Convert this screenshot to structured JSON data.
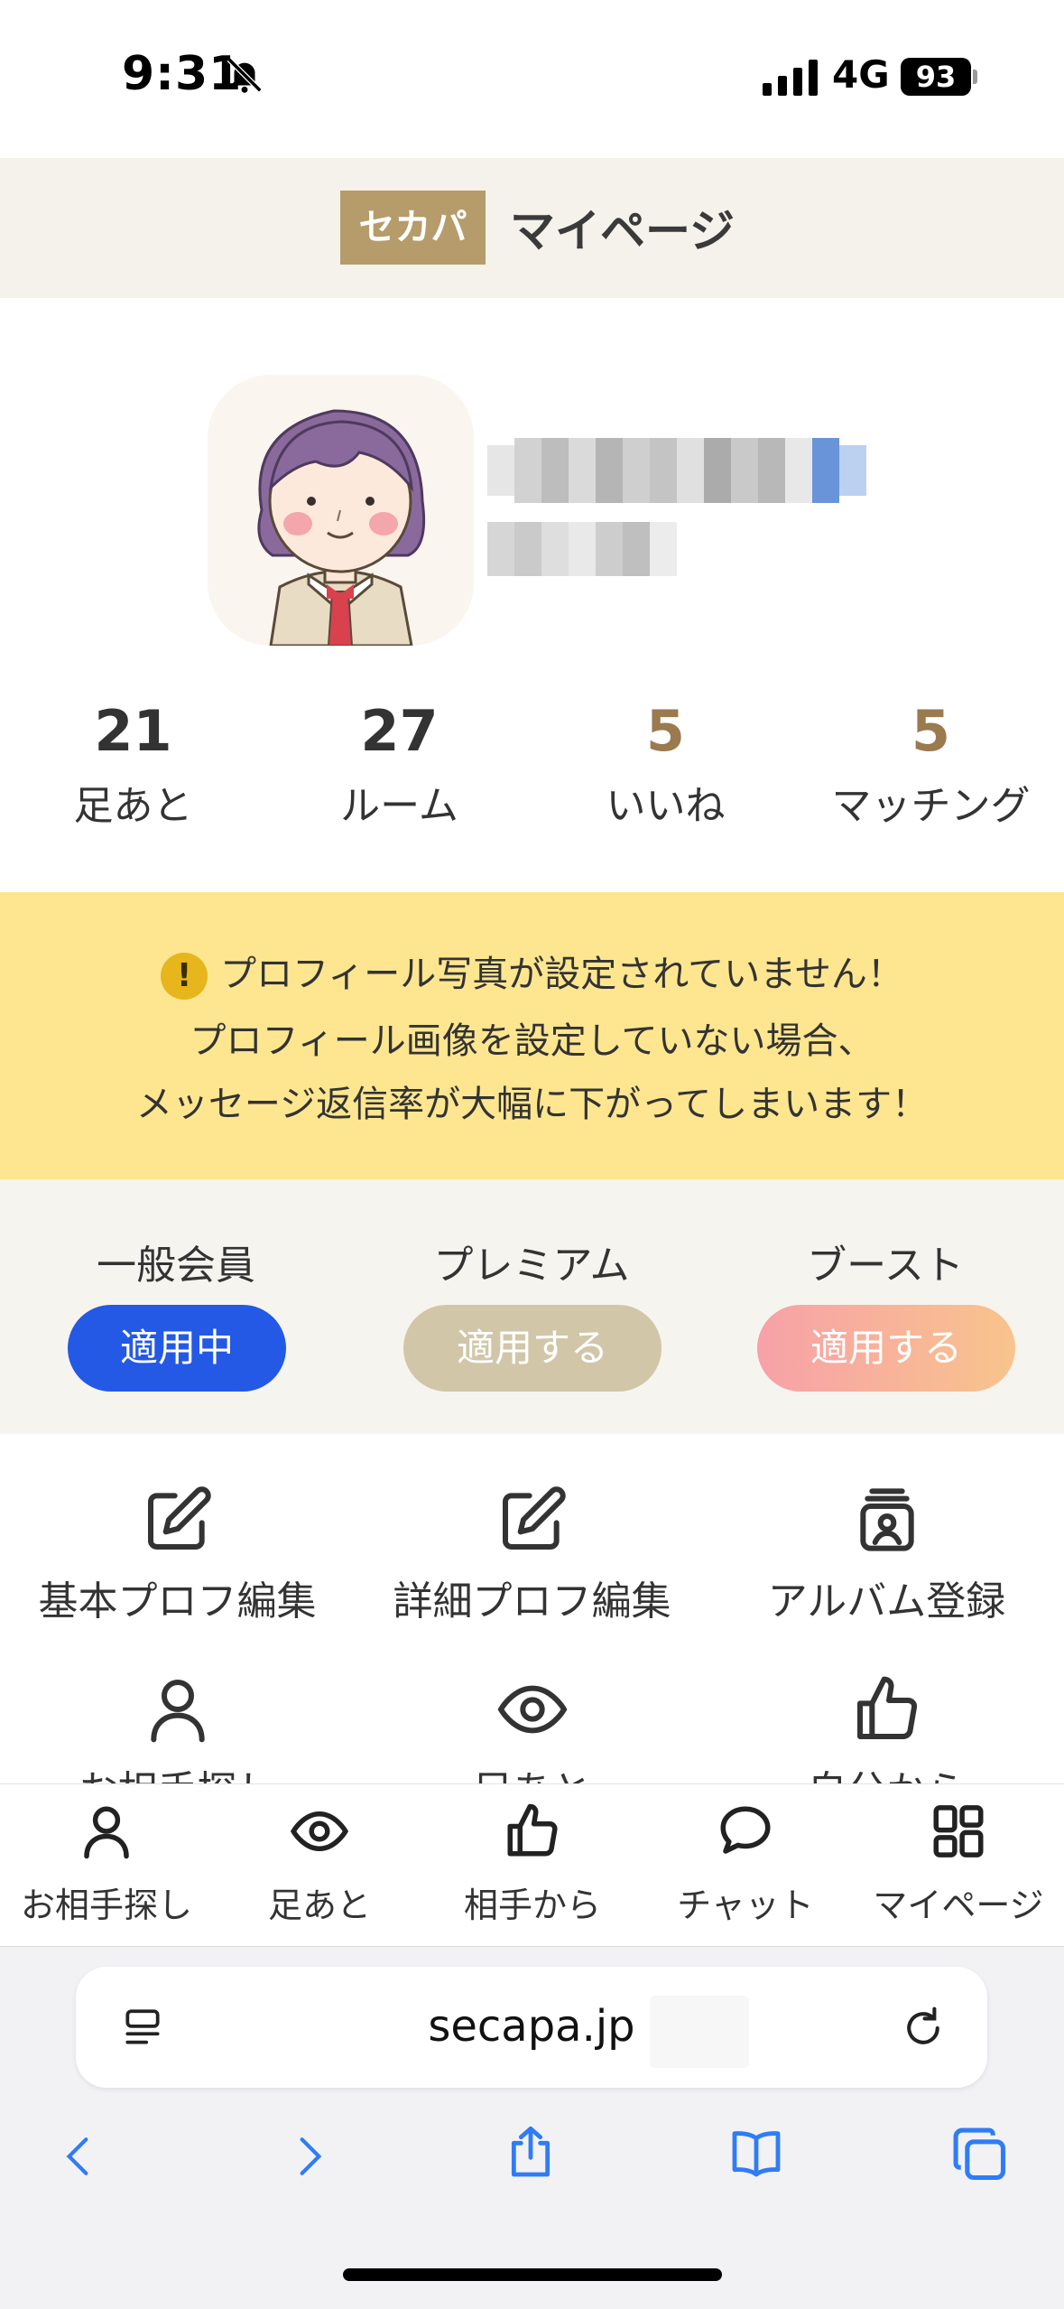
{
  "status_bar": {
    "time": "9:31",
    "network": "4G",
    "battery": "93"
  },
  "header": {
    "brand": "セカパ",
    "title": "マイページ"
  },
  "stats": [
    {
      "value": "21",
      "label": "足あと",
      "color": "#333333"
    },
    {
      "value": "27",
      "label": "ルーム",
      "color": "#333333"
    },
    {
      "value": "5",
      "label": "いいね",
      "color": "#9a7a4e"
    },
    {
      "value": "5",
      "label": "マッチング",
      "color": "#9a7a4e"
    }
  ],
  "warning": {
    "line1": "プロフィール写真が設定されていません！",
    "line2": "プロフィール画像を設定していない場合、",
    "line3": "メッセージ返信率が大幅に下がってしまいます！"
  },
  "plans": [
    {
      "label": "一般会員",
      "button": "適用中"
    },
    {
      "label": "プレミアム",
      "button": "適用する"
    },
    {
      "label": "ブースト",
      "button": "適用する"
    }
  ],
  "menu": [
    {
      "label": "基本プロフ編集",
      "icon": "edit-icon"
    },
    {
      "label": "詳細プロフ編集",
      "icon": "edit-icon"
    },
    {
      "label": "アルバム登録",
      "icon": "album-icon"
    },
    {
      "label": "お相手探し",
      "icon": "person-icon"
    },
    {
      "label": "足あと",
      "icon": "eye-icon"
    },
    {
      "label": "自分から",
      "icon": "thumbs-up-icon"
    }
  ],
  "tabs": [
    {
      "label": "お相手探し",
      "icon": "person-icon"
    },
    {
      "label": "足あと",
      "icon": "eye-icon"
    },
    {
      "label": "相手から",
      "icon": "thumbs-up-icon"
    },
    {
      "label": "チャット",
      "icon": "chat-icon"
    },
    {
      "label": "マイページ",
      "icon": "grid-icon"
    }
  ],
  "browser": {
    "url": "secapa.jp"
  },
  "colors": {
    "brand": "#b69c6b",
    "active_plan": "#2459e5",
    "premium": "#d2c6a9",
    "boost_from": "#f7a1a8",
    "boost_to": "#f8c48c",
    "warning_bg": "#fde68f",
    "safari_blue": "#2f7cf6"
  }
}
